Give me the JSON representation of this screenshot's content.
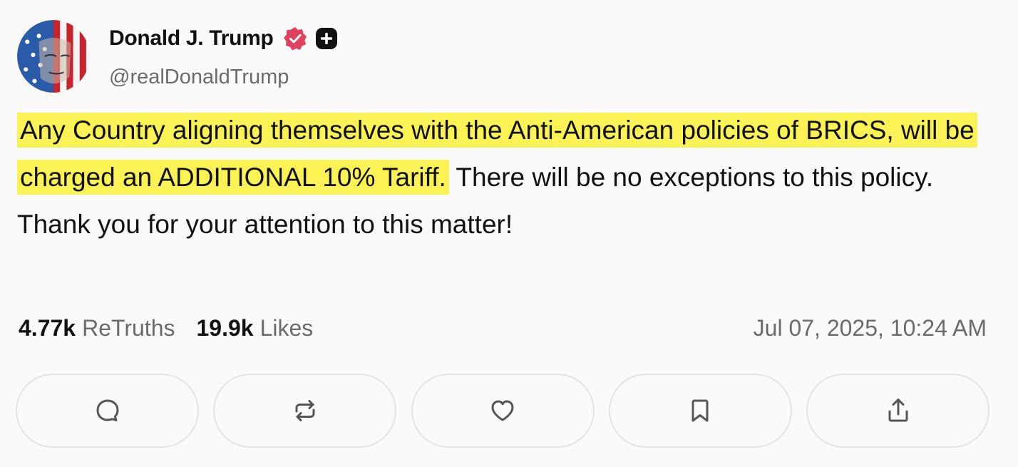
{
  "post": {
    "author": {
      "display_name": "Donald J. Trump",
      "handle": "@realDonaldTrump",
      "avatar_icon": "flag-portrait-avatar",
      "verified_badge_icon": "verified-badge-icon",
      "verified_badge_color": "#e0415d",
      "plus_badge_icon": "truth-plus-icon"
    },
    "text": {
      "highlighted": "Any Country aligning themselves with the Anti-American policies of BRICS, will be charged an ADDITIONAL 10% Tariff.",
      "rest": " There will be no exceptions to this policy. Thank you for your attention to this matter!"
    },
    "highlight_color": "#fbf256",
    "stats": {
      "retruths_count": "4.77k",
      "retruths_label": "ReTruths",
      "likes_count": "19.9k",
      "likes_label": "Likes"
    },
    "timestamp": "Jul 07, 2025, 10:24 AM",
    "actions": [
      {
        "name": "reply",
        "icon": "reply-bubble-icon"
      },
      {
        "name": "retruth",
        "icon": "retruth-arrows-icon"
      },
      {
        "name": "like",
        "icon": "heart-icon"
      },
      {
        "name": "bookmark",
        "icon": "bookmark-icon"
      },
      {
        "name": "share",
        "icon": "share-upload-icon"
      }
    ]
  }
}
